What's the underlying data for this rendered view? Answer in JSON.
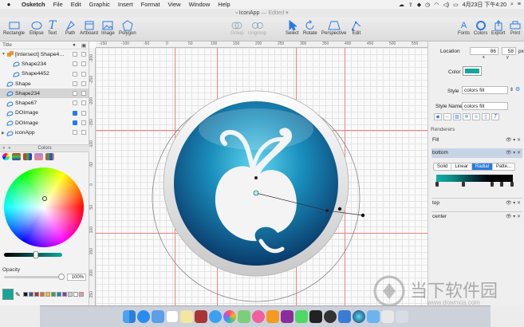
{
  "menubar": {
    "apple": "",
    "items": [
      "Osketch",
      "File",
      "Edit",
      "Graphic",
      "Insert",
      "Format",
      "View",
      "Window",
      "Help"
    ],
    "datetime": "4月23日 下午4:20"
  },
  "window": {
    "title": "IconApp",
    "status": "— Edited ▾"
  },
  "toolbar": {
    "left": [
      "Rectangle",
      "Ellipse",
      "Text",
      "Path",
      "Artboard",
      "Image",
      "Polygon"
    ],
    "center_dim": [
      "Group",
      "Ungroup"
    ],
    "center": [
      "Select",
      "Rotate",
      "Perspective",
      "Edit"
    ],
    "right": [
      "Fonts",
      "Colors",
      "Export",
      "Print"
    ]
  },
  "layers": {
    "header": "Title",
    "items": [
      {
        "name": "[Intersect] Shape4…",
        "level": 0,
        "expanded": true,
        "selected": false,
        "check": false
      },
      {
        "name": "Shape234",
        "level": 1,
        "selected": false,
        "check": false
      },
      {
        "name": "Shape4452",
        "level": 1,
        "selected": false,
        "check": false
      },
      {
        "name": "Shape",
        "level": 0,
        "selected": false,
        "check": false
      },
      {
        "name": "Shape234",
        "level": 0,
        "selected": true,
        "check": false
      },
      {
        "name": "Shape67",
        "level": 0,
        "selected": false,
        "check": false
      },
      {
        "name": "DOImage",
        "level": 0,
        "selected": false,
        "check": true
      },
      {
        "name": "DOImage",
        "level": 0,
        "selected": false,
        "check": true
      },
      {
        "name": "iconApp",
        "level": 0,
        "expanded": false,
        "selected": false,
        "check": false
      }
    ]
  },
  "colors_panel": {
    "title": "Colors",
    "opacity_label": "Opacity",
    "opacity_value": "100%",
    "opacity_fraction": 1.0,
    "brightness_fraction": 0.55,
    "current_color": "#11a89a",
    "swatches": [
      "#1a1a1a",
      "#3a5a8a",
      "#b03030",
      "#e07030",
      "#f0c030",
      "#40a040",
      "#2080c0",
      "#8040a0",
      "#d0d0d0",
      "#ffffff",
      "#e0a0a0"
    ]
  },
  "ruler": {
    "h_ticks": [
      "-150",
      "-100",
      "-50",
      "0",
      "50",
      "100",
      "150",
      "200",
      "250",
      "300",
      "350",
      "400",
      "450",
      "500",
      "550"
    ],
    "v_ticks": [
      "-300",
      "-250",
      "-200",
      "-150",
      "-100",
      "-50",
      "0",
      "50",
      "100",
      "150",
      "200",
      "250"
    ]
  },
  "inspector": {
    "location_label": "Location",
    "x_value": "86",
    "y_value": "58",
    "x_label": "x",
    "y_label": "y",
    "unit": "px",
    "color_label": "Color",
    "color_value": "#11a89a",
    "style_label": "Style",
    "style_value": "colors fill",
    "style_name_label": "Style Name",
    "style_name_value": "colors fill",
    "renderers_label": "Renderers",
    "sections": [
      "Fill",
      "bottom",
      "top",
      "center"
    ],
    "fill_tabs": [
      "Solid",
      "Linear",
      "Radial",
      "Patte..."
    ],
    "active_fill_tab": "Radial"
  },
  "watermark": {
    "cn": "当下软件园",
    "url": "www.downxia.com"
  }
}
